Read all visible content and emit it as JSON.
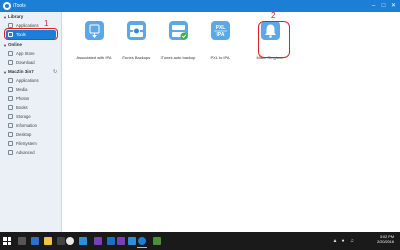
{
  "window": {
    "title": "iTools",
    "minimize": "–",
    "maximize": "□",
    "close": "✕"
  },
  "sidebar": {
    "library": {
      "header": "Library",
      "items": [
        {
          "label": "Applications",
          "icon": "applications-icon"
        },
        {
          "label": "Tools",
          "icon": "tools-icon",
          "active": true
        }
      ]
    },
    "online": {
      "header": "Online",
      "items": [
        {
          "label": "App Store",
          "icon": "app-store-icon"
        },
        {
          "label": "Download",
          "icon": "download-icon"
        }
      ]
    },
    "device": {
      "header": "MacZin 3in7",
      "items": [
        {
          "label": "Applications",
          "icon": "applications-icon"
        },
        {
          "label": "Media",
          "icon": "media-icon"
        },
        {
          "label": "Photos",
          "icon": "photos-icon"
        },
        {
          "label": "Books",
          "icon": "books-icon"
        },
        {
          "label": "Storage",
          "icon": "storage-icon"
        },
        {
          "label": "Information",
          "icon": "information-icon"
        },
        {
          "label": "Desktop",
          "icon": "desktop-icon"
        },
        {
          "label": "FileSystem",
          "icon": "filesystem-icon"
        },
        {
          "label": "Advanced",
          "icon": "advanced-icon"
        }
      ]
    }
  },
  "tools": [
    {
      "label": "Associated with IPA",
      "icon": "ipa-association-icon"
    },
    {
      "label": "iTunes Backups",
      "icon": "itunes-backup-icon"
    },
    {
      "label": "iTunes auto backup",
      "icon": "itunes-auto-backup-icon"
    },
    {
      "label": "PXL to IPA",
      "icon": "pxl-ipa-icon",
      "icon_text_top": "PXL",
      "icon_text_bottom": "IPA"
    },
    {
      "label": "Make Ringtone",
      "icon": "bell-icon"
    }
  ],
  "annotations": {
    "marker_1": "1",
    "marker_2": "2",
    "color": "#e02020"
  },
  "taskbar": {
    "time": "3:02 PM",
    "date": "2/20/2016"
  },
  "colors": {
    "accent": "#1d7ed6",
    "icon_blue": "#5aa8e6"
  }
}
